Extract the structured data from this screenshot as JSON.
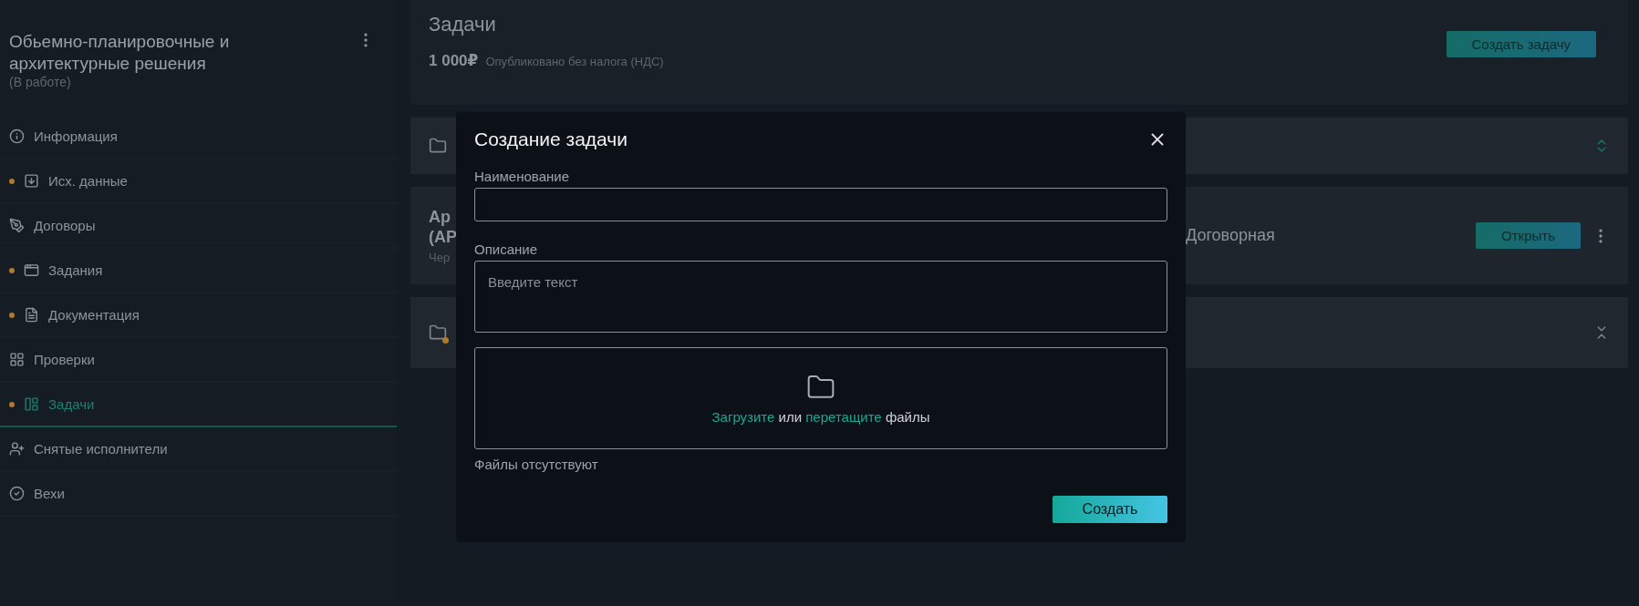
{
  "sidebar": {
    "title": "Обьемно-планировочные и архитектурные решения",
    "status": "(В работе)",
    "items": [
      {
        "label": "Информация",
        "marked": false,
        "selected": false
      },
      {
        "label": "Исх. данные",
        "marked": true,
        "selected": false
      },
      {
        "label": "Договоры",
        "marked": false,
        "selected": false
      },
      {
        "label": "Задания",
        "marked": true,
        "selected": false
      },
      {
        "label": "Документация",
        "marked": true,
        "selected": false
      },
      {
        "label": "Проверки",
        "marked": false,
        "selected": false
      },
      {
        "label": "Задачи",
        "marked": true,
        "selected": true
      },
      {
        "label": "Снятые исполнители",
        "marked": false,
        "selected": false
      },
      {
        "label": "Вехи",
        "marked": false,
        "selected": false
      }
    ]
  },
  "header": {
    "title": "Задачи",
    "amount": "1 000₽",
    "note": "Опубликовано без налога (НДС)",
    "button": "Создать задачу"
  },
  "groups": [
    {
      "kind": "folder",
      "marked": false,
      "expanded": false
    },
    {
      "kind": "task",
      "title_lines": [
        "Ар",
        "(АР"
      ],
      "subtitle": "Чер",
      "price": "Договорная",
      "button": "Открыть"
    },
    {
      "kind": "folder",
      "marked": true,
      "expanded": true
    }
  ],
  "modal": {
    "title": "Создание задачи",
    "fields": [
      {
        "kind": "input",
        "label": "Наименование"
      },
      {
        "kind": "textarea",
        "label": "Описание",
        "placeholder": "Введите текст"
      }
    ],
    "dropzone": [
      {
        "kind": "link",
        "text": "Загрузите"
      },
      {
        "kind": "text",
        "text": "или"
      },
      {
        "kind": "link",
        "text": "перетащите"
      },
      {
        "kind": "text",
        "text": "файлы"
      }
    ],
    "files_note": "Файлы отсутствуют",
    "submit": "Создать"
  }
}
